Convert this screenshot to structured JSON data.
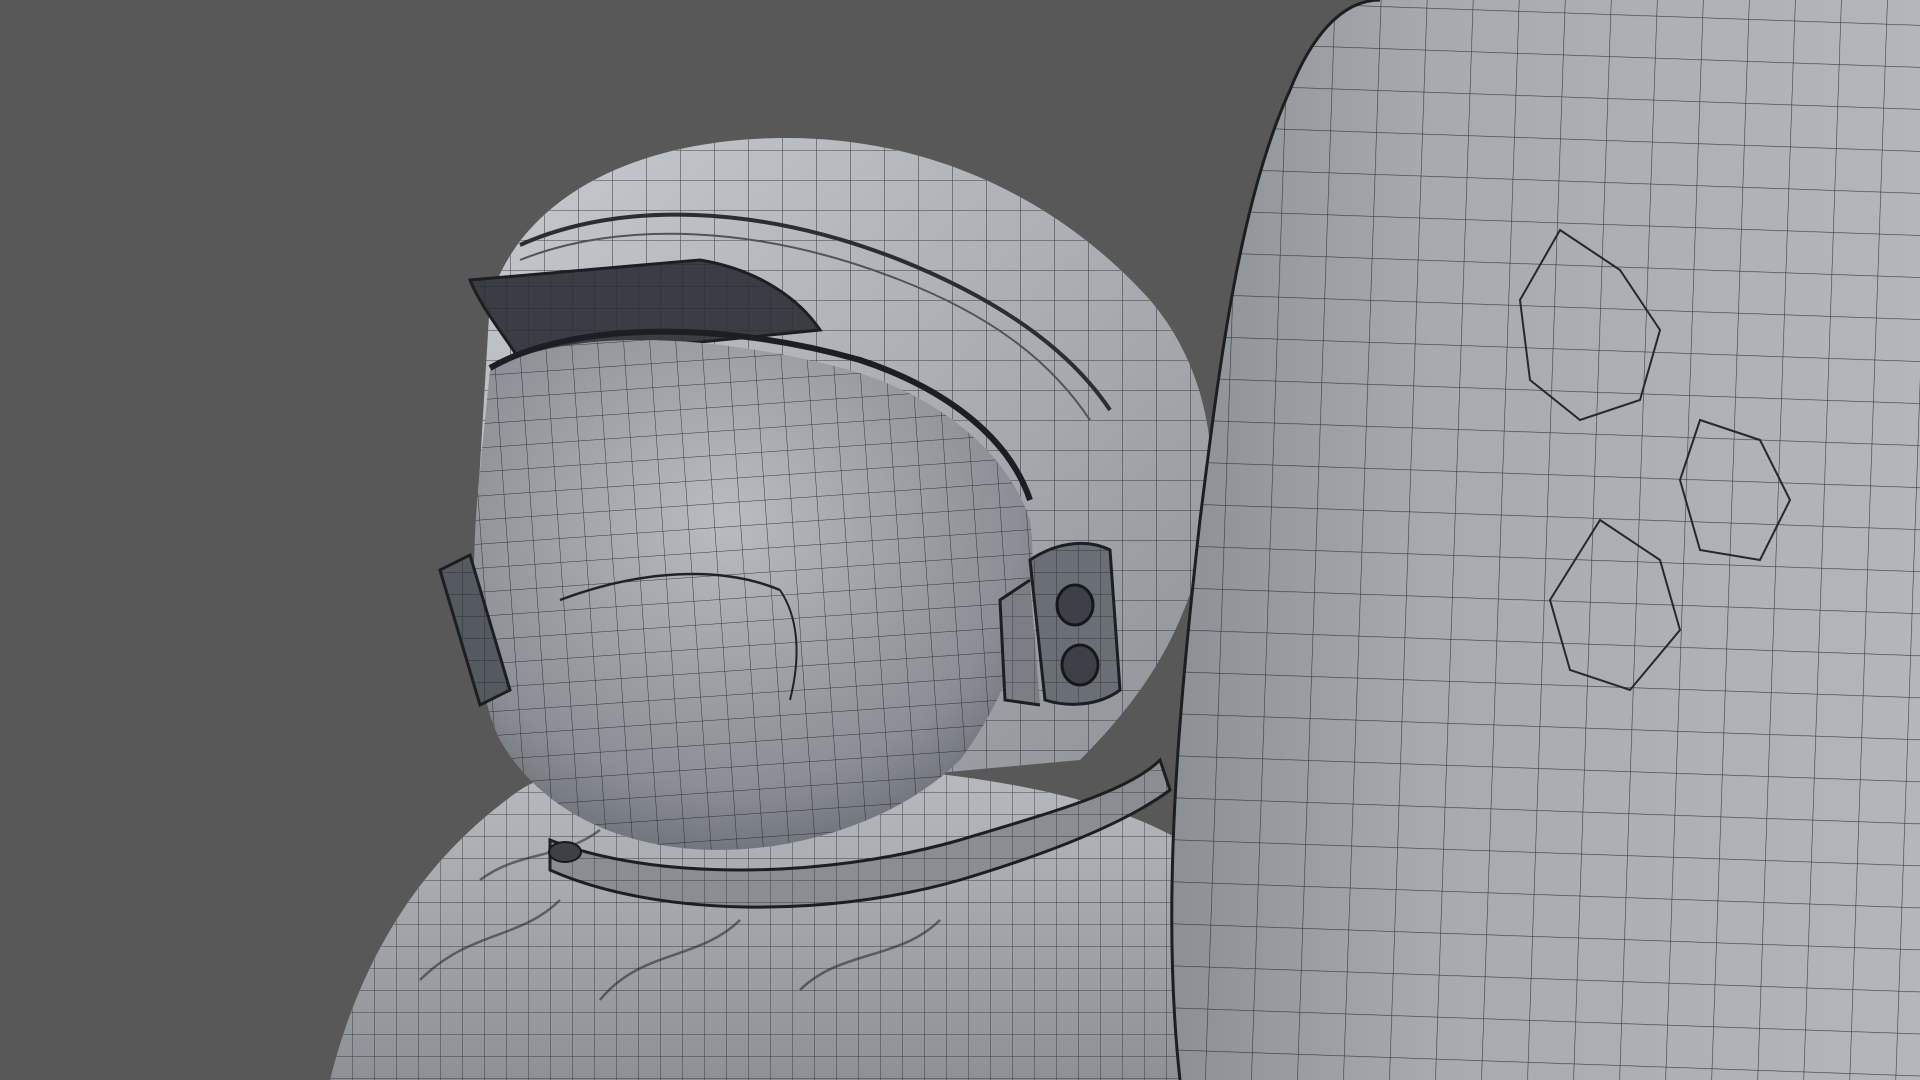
{
  "scene": {
    "subject": "astronaut-wireframe-render",
    "colors": {
      "background": "#585858",
      "surface": "#9b9ea3",
      "surface_light": "#c2c5c9",
      "surface_dark": "#6b6f75",
      "wire": "#1f2226",
      "visor_band": "#2e3238"
    },
    "icons": {
      "helmet": "helmet-icon",
      "backpack": "backpack-icon",
      "torso": "suit-torso-icon"
    }
  }
}
